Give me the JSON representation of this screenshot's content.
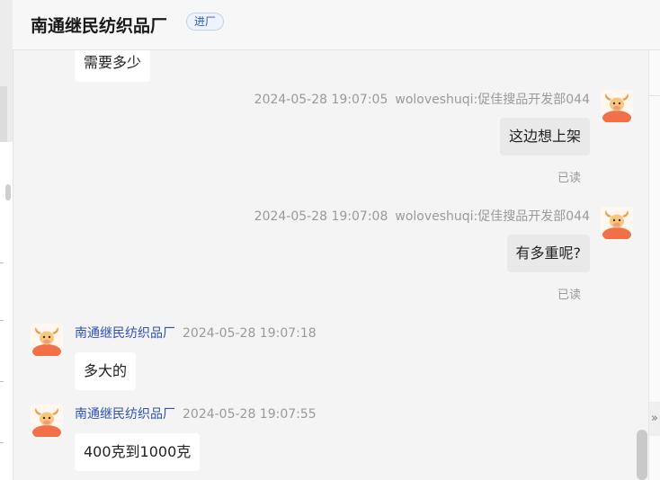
{
  "header": {
    "title": "南通继民纺织品厂",
    "badge": "进厂"
  },
  "side_panel": {
    "expand_icon": "»"
  },
  "messages": [
    {
      "from": "other",
      "text": "需要多少"
    },
    {
      "from": "me",
      "time": "2024-05-28 19:07:05",
      "sender": "woloveshuqi:促佳搜品开发部044",
      "text": "这边想上架",
      "status": "已读"
    },
    {
      "from": "me",
      "time": "2024-05-28 19:07:08",
      "sender": "woloveshuqi:促佳搜品开发部044",
      "text": "有多重呢?",
      "status": "已读"
    },
    {
      "from": "other",
      "sender": "南通继民纺织品厂",
      "time": "2024-05-28 19:07:18",
      "text": "多大的"
    },
    {
      "from": "other",
      "sender": "南通继民纺织品厂",
      "time": "2024-05-28 19:07:55",
      "text": "400克到1000克"
    }
  ],
  "colors": {
    "accent": "#2f52b0",
    "avatar_orange": "#f0704a"
  }
}
